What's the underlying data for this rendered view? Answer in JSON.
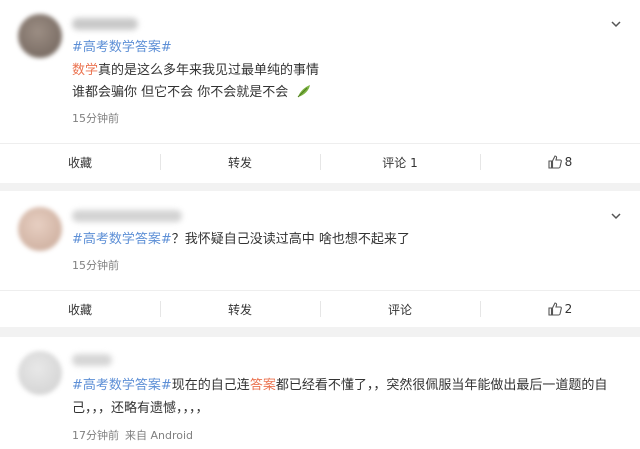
{
  "posts": [
    {
      "hashtag": "#高考数学答案#",
      "line1_highlight": "数学",
      "line1_rest": "真的是这么多年来我见过最单纯的事情",
      "line2": "谁都会骗你 但它不会 你不会就是不会",
      "time": "15分钟前",
      "actions": {
        "collect": "收藏",
        "repost": "转发",
        "comment": "评论 1",
        "like": "8"
      }
    },
    {
      "hashtag": "#高考数学答案#",
      "text": "？我怀疑自己没读过高中 啥也想不起来了",
      "time": "15分钟前",
      "actions": {
        "collect": "收藏",
        "repost": "转发",
        "comment": "评论",
        "like": "2"
      }
    },
    {
      "hashtag": "#高考数学答案#",
      "text_a": "现在的自己连",
      "text_hl": "答案",
      "text_b": "都已经看不懂了，，突然很佩服当年能做出最后一道题的自",
      "line2": "己，，，还略有遗憾，，，，",
      "time": "17分钟前",
      "source": "来自 Android"
    }
  ],
  "icons": {
    "chevron": "chevron-down-icon",
    "like": "thumbs-up-icon",
    "emoji": "leaf-emoji-icon"
  },
  "colors": {
    "hashtag": "#5d8fd6",
    "highlight": "#eb7350",
    "background": "#f2f2f2"
  }
}
